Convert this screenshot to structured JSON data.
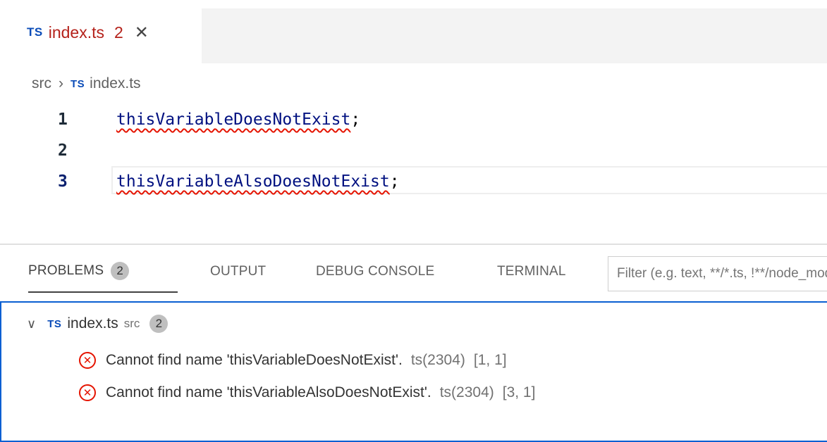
{
  "editor_tab": {
    "lang_badge": "TS",
    "file_name": "index.ts",
    "problem_count": "2",
    "close_glyph": "✕"
  },
  "breadcrumb": {
    "folder": "src",
    "separator": "›",
    "lang_badge": "TS",
    "file": "index.ts"
  },
  "code": {
    "lines": [
      {
        "number": "1",
        "identifier": "thisVariableDoesNotExist",
        "punct": ";"
      },
      {
        "number": "2",
        "identifier": "",
        "punct": ""
      },
      {
        "number": "3",
        "identifier": "thisVariableAlsoDoesNotExist",
        "punct": ";"
      }
    ]
  },
  "panel": {
    "tabs": {
      "problems": "PROBLEMS",
      "problems_count": "2",
      "output": "OUTPUT",
      "debug_console": "DEBUG CONSOLE",
      "terminal": "TERMINAL"
    },
    "filter_placeholder": "Filter (e.g. text, **/*.ts, !**/node_modules/**)"
  },
  "problems": {
    "file": {
      "chevron": "∨",
      "lang_badge": "TS",
      "name": "index.ts",
      "path": "src",
      "count": "2"
    },
    "items": [
      {
        "message": "Cannot find name 'thisVariableDoesNotExist'.",
        "source": "ts(2304)",
        "position": "[1, 1]"
      },
      {
        "message": "Cannot find name 'thisVariableAlsoDoesNotExist'.",
        "source": "ts(2304)",
        "position": "[3, 1]"
      }
    ]
  },
  "colors": {
    "error": "#e51400",
    "ts_badge": "#0b4cb8",
    "focus_border": "#0a5fd2",
    "tab_error_text": "#b5221b"
  },
  "icons": [
    "close-icon",
    "chevron-right-icon",
    "chevron-down-icon",
    "error-icon"
  ]
}
